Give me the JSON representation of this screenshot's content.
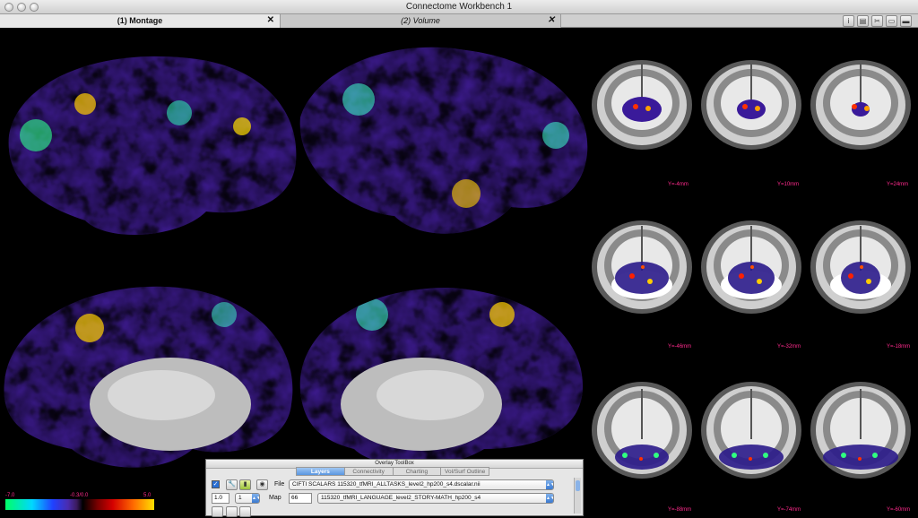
{
  "window": {
    "title": "Connectome Workbench 1"
  },
  "tabs": [
    {
      "label": "(1) Montage",
      "close": "✕"
    },
    {
      "label": "(2) Volume",
      "close": "✕"
    }
  ],
  "toolbar_icons": [
    "info-icon",
    "capture-icon",
    "tools-icon",
    "view-icon",
    "toolbox-icon"
  ],
  "mri_labels": [
    "Y=-4mm",
    "Y=10mm",
    "Y=24mm",
    "Y=-46mm",
    "Y=-32mm",
    "Y=-18mm",
    "Y=-88mm",
    "Y=-74mm",
    "Y=-60mm"
  ],
  "colorbar": {
    "min": "-7.0",
    "mid": "-0.3/0.0",
    "max": "5.0"
  },
  "toolbox": {
    "title": "Overlay ToolBox",
    "tabs": [
      "Layers",
      "Connectivity",
      "Charting",
      "Vol/Surf Outline"
    ],
    "active_tab": "Layers",
    "row1": {
      "label": "File",
      "file": "CIFTI SCALARS 115320_tfMRI_ALLTASKS_level2_hp200_s4.dscalar.nii"
    },
    "row2": {
      "opacity": "1.0",
      "yoke": "1",
      "label": "Map",
      "index": "66",
      "map": "115320_tfMRI_LANGUAGE_level2_STORY-MATH_hp200_s4"
    }
  },
  "colors": {
    "accent": "#ff2a8c",
    "tab_active": "#5a96e0"
  }
}
